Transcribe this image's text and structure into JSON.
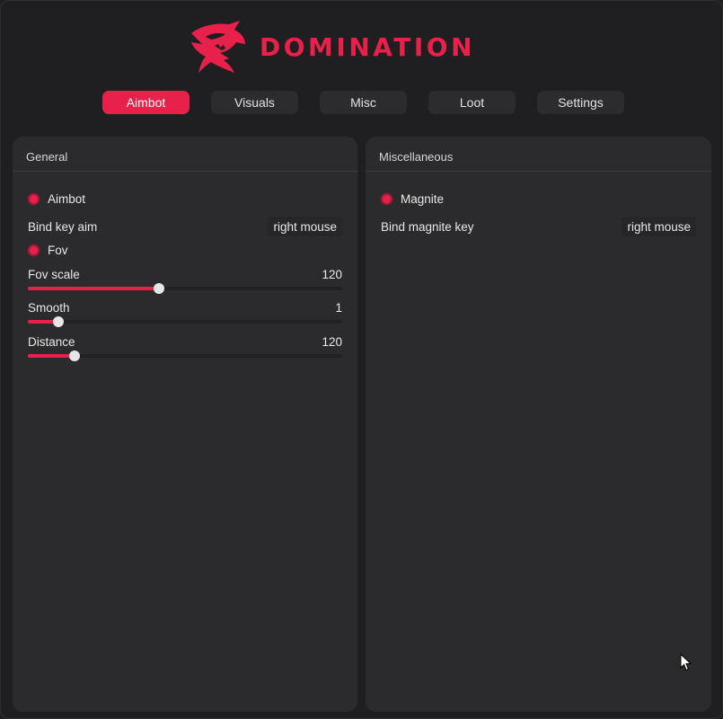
{
  "brand": {
    "name": "DOMINATION",
    "accent": "#e8214a"
  },
  "tabs": [
    {
      "label": "Aimbot",
      "active": true
    },
    {
      "label": "Visuals",
      "active": false
    },
    {
      "label": "Misc",
      "active": false
    },
    {
      "label": "Loot",
      "active": false
    },
    {
      "label": "Settings",
      "active": false
    }
  ],
  "general": {
    "title": "General",
    "aimbot": {
      "label": "Aimbot",
      "checked": true
    },
    "bind": {
      "label": "Bind key aim",
      "value": "right mouse"
    },
    "fov": {
      "label": "Fov",
      "checked": true
    },
    "fov_scale": {
      "label": "Fov scale",
      "value": "120",
      "fraction": 0.417
    },
    "smooth": {
      "label": "Smooth",
      "value": "1",
      "fraction": 0.096
    },
    "distance": {
      "label": "Distance",
      "value": "120",
      "fraction": 0.149
    }
  },
  "misc": {
    "title": "Miscellaneous",
    "magnite": {
      "label": "Magnite",
      "checked": true
    },
    "bind": {
      "label": "Bind magnite key",
      "value": "right mouse"
    }
  },
  "icons": {
    "logo": "shark-logo-icon",
    "radio": "radio-on-icon",
    "cursor": "mouse-pointer-icon"
  }
}
